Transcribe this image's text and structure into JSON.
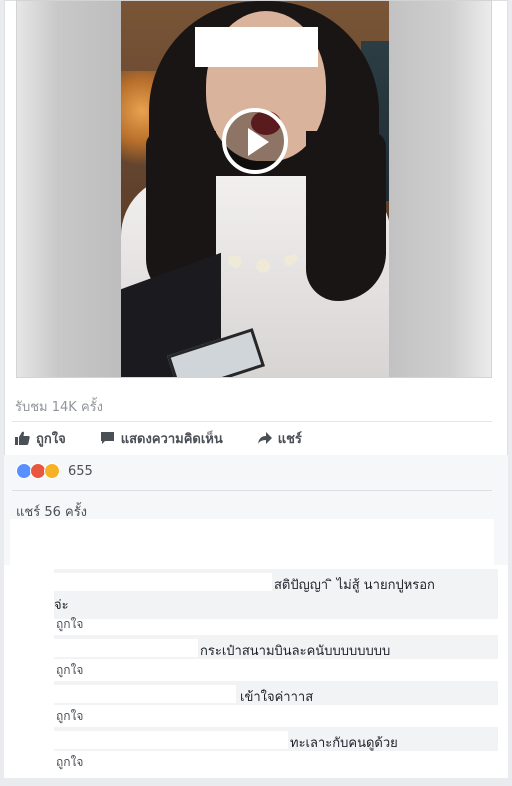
{
  "post": {
    "views": "รับชม 14K ครั้ง",
    "actions": {
      "like": "ถูกใจ",
      "comment": "แสดงความคิดเห็น",
      "share": "แชร์"
    },
    "reaction_count": "655",
    "share_count": "แชร์ 56 ครั้ง"
  },
  "comments": [
    {
      "text": "สติปัญญา ิ ไม่สู้ นายกปูหรอก",
      "text_cont": "จ่ะ",
      "like_label": "ถูกใจ"
    },
    {
      "text": "กระเป๋าสนามบินละคนับบบบบบบบ",
      "like_label": "ถูกใจ"
    },
    {
      "text": "เข้าใจค่าาาส",
      "like_label": "ถูกใจ"
    },
    {
      "text": "ทะเลาะกับคนดูด้วย",
      "like_label": "ถูกใจ"
    }
  ],
  "colors": {
    "link": "#4b4f56",
    "muted": "#90949c",
    "accent": "#4267b2"
  }
}
